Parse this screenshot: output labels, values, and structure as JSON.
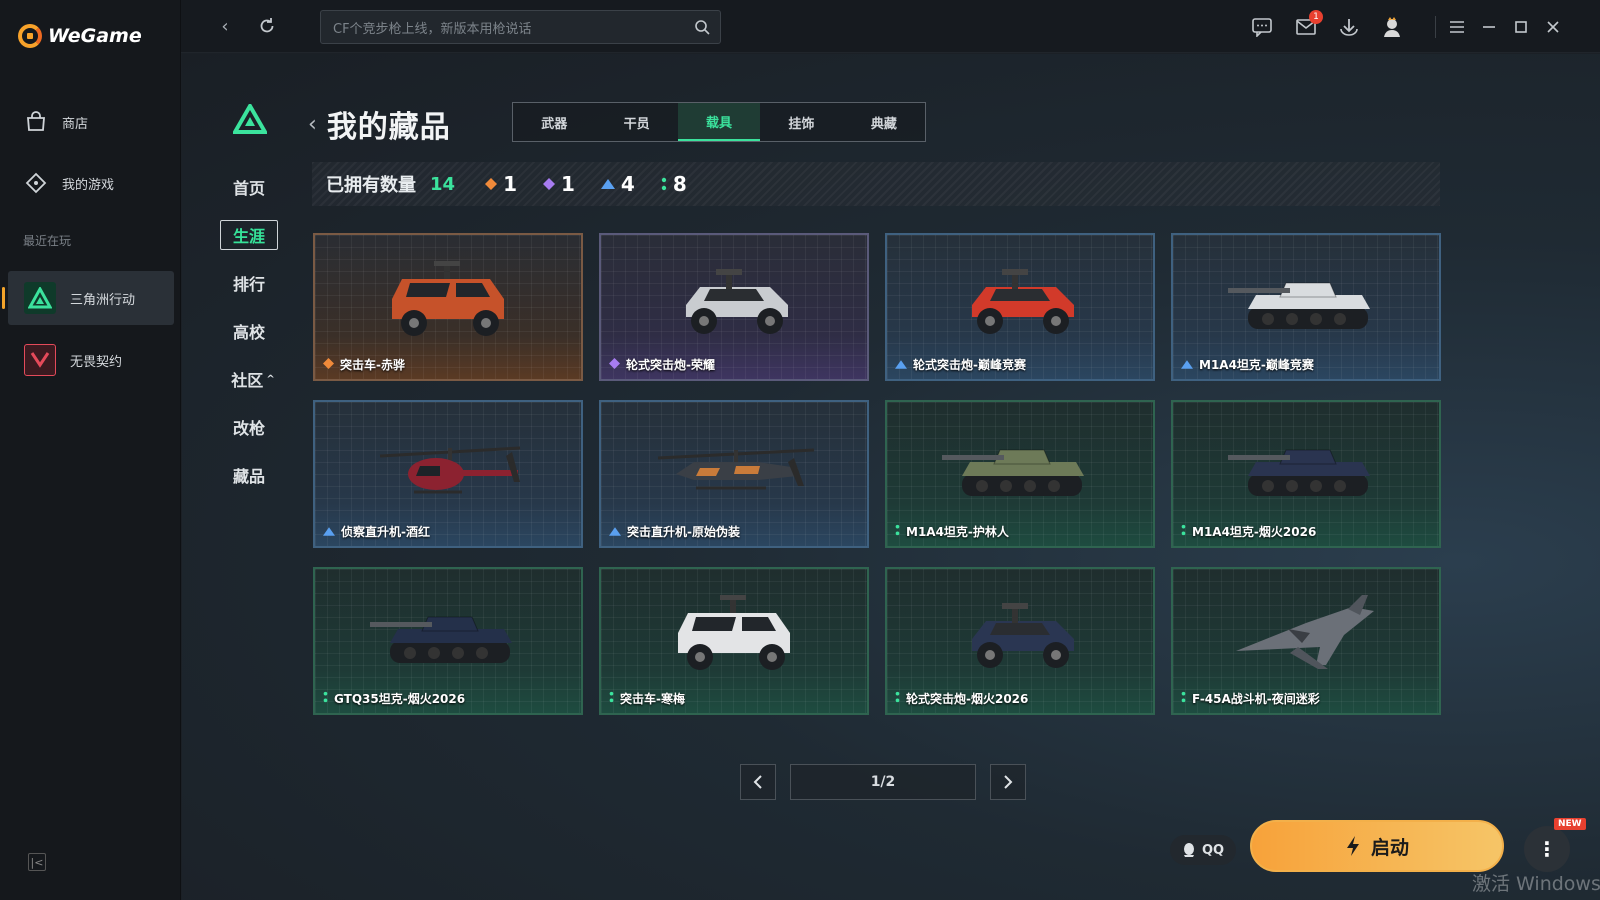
{
  "app": {
    "name": "WeGame"
  },
  "sidebar": {
    "items": [
      {
        "label": "商店",
        "icon": "bag-icon"
      },
      {
        "label": "我的游戏",
        "icon": "gamepad-icon"
      }
    ],
    "recent_label": "最近在玩",
    "recent": [
      {
        "label": "三角洲行动",
        "icon": "delta-force-icon",
        "active": true
      },
      {
        "label": "无畏契约",
        "icon": "valorant-icon",
        "active": false
      }
    ]
  },
  "topbar": {
    "search_placeholder": "CF个竞步枪上线，新版本用枪说话",
    "mail_badge": "1"
  },
  "subnav": {
    "items": [
      {
        "label": "首页"
      },
      {
        "label": "生涯",
        "active": true
      },
      {
        "label": "排行"
      },
      {
        "label": "高校"
      },
      {
        "label": "社区",
        "caret": "^"
      },
      {
        "label": "改枪"
      },
      {
        "label": "藏品"
      }
    ]
  },
  "page": {
    "title": "我的藏品",
    "tabs": [
      {
        "label": "武器"
      },
      {
        "label": "干员"
      },
      {
        "label": "载具",
        "active": true
      },
      {
        "label": "挂饰"
      },
      {
        "label": "典藏"
      }
    ],
    "owned_label": "已拥有数量",
    "owned_total": "14",
    "rarity_counts": [
      {
        "rarity": "orange",
        "color": "#f08a3a",
        "count": "1"
      },
      {
        "rarity": "purple",
        "color": "#a77cf0",
        "count": "1"
      },
      {
        "rarity": "blue",
        "color": "#5aa0f0",
        "count": "4"
      },
      {
        "rarity": "green",
        "color": "#3be39d",
        "count": "8"
      }
    ]
  },
  "items": [
    {
      "name": "突击车-赤骅",
      "rarity": "orange",
      "type": "armored-car",
      "color": "#c6522a"
    },
    {
      "name": "轮式突击炮-荣耀",
      "rarity": "purple",
      "type": "buggy",
      "color": "#c9ccd0"
    },
    {
      "name": "轮式突击炮-巅峰竞赛",
      "rarity": "blue",
      "type": "buggy",
      "color": "#d23a2a"
    },
    {
      "name": "M1A4坦克-巅峰竞赛",
      "rarity": "blue",
      "type": "tank",
      "color": "#d9dcdf"
    },
    {
      "name": "侦察直升机-酒红",
      "rarity": "blue",
      "type": "heli-small",
      "color": "#8c2230"
    },
    {
      "name": "突击直升机-原始伪装",
      "rarity": "blue",
      "type": "heli-attack",
      "color": "#3a3f46"
    },
    {
      "name": "M1A4坦克-护林人",
      "rarity": "green",
      "type": "tank",
      "color": "#6d7a58"
    },
    {
      "name": "M1A4坦克-烟火2026",
      "rarity": "green",
      "type": "tank",
      "color": "#2a3450"
    },
    {
      "name": "GTQ35坦克-烟火2026",
      "rarity": "green",
      "type": "tank",
      "color": "#24304a"
    },
    {
      "name": "突击车-寒梅",
      "rarity": "green",
      "type": "armored-car",
      "color": "#e3e4e6"
    },
    {
      "name": "轮式突击炮-烟火2026",
      "rarity": "green",
      "type": "buggy",
      "color": "#2a3652"
    },
    {
      "name": "F-45A战斗机-夜间迷彩",
      "rarity": "green",
      "type": "jet",
      "color": "#6b7078"
    }
  ],
  "pagination": {
    "label": "1/2"
  },
  "launch": {
    "qq_label": "QQ",
    "start_label": "启动",
    "new_tag": "NEW"
  },
  "watermark": "激活 Windows"
}
